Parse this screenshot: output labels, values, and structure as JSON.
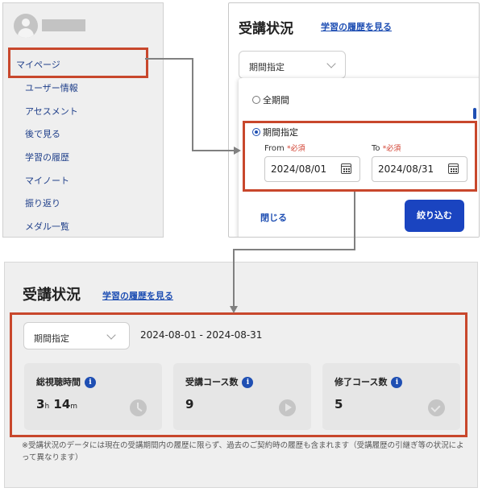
{
  "sidebar": {
    "mypage_label": "マイページ",
    "items": [
      {
        "label": "ユーザー情報"
      },
      {
        "label": "アセスメント"
      },
      {
        "label": "後で見る"
      },
      {
        "label": "学習の履歴"
      },
      {
        "label": "マイノート"
      },
      {
        "label": "振り返り"
      },
      {
        "label": "メダル一覧"
      }
    ]
  },
  "filter_panel": {
    "title": "受講状況",
    "history_link": "学習の履歴を見る",
    "dropdown_value": "期間指定",
    "options": [
      {
        "label": "全期間",
        "selected": false
      },
      {
        "label": "期間指定",
        "selected": true
      }
    ],
    "from_label": "From",
    "to_label": "To",
    "required_mark": "*必須",
    "from_value": "2024/08/01",
    "to_value": "2024/08/31",
    "close_label": "閉じる",
    "apply_label": "絞り込む"
  },
  "result_panel": {
    "title": "受講状況",
    "history_link": "学習の履歴を見る",
    "dropdown_value": "期間指定",
    "date_range": "2024-08-01 - 2024-08-31",
    "stats": [
      {
        "title": "総視聴時間",
        "value_main": "3",
        "value_unit1": "h",
        "value_main2": "14",
        "value_unit2": "m",
        "icon": "clock-icon"
      },
      {
        "title": "受講コース数",
        "value": "9",
        "icon": "play-icon"
      },
      {
        "title": "修了コース数",
        "value": "5",
        "icon": "check-circle-icon"
      }
    ],
    "info_glyph": "i",
    "footnote": "※受講状況のデータには現在の受講期間内の履歴に限らず、過去のご契約時の履歴も含まれます（受講履歴の引継ぎ等の状況によって異なります）"
  },
  "colors": {
    "highlight": "#c8472c",
    "link": "#1f4fb3",
    "primary_button": "#1a44c0"
  }
}
